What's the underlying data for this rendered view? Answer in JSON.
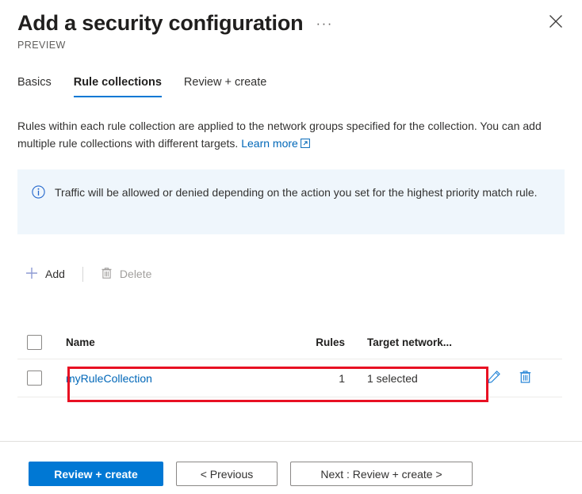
{
  "header": {
    "title": "Add a security configuration",
    "preview_label": "PREVIEW",
    "more_menu": "···",
    "close_icon": "close-icon"
  },
  "tabs": [
    {
      "label": "Basics",
      "active": false
    },
    {
      "label": "Rule collections",
      "active": true
    },
    {
      "label": "Review + create",
      "active": false
    }
  ],
  "description": {
    "line1": "Rules within each rule collection are applied to the network groups specified for the collection.",
    "line2": "You can add multiple rule collections with different targets.",
    "link_label": "Learn more",
    "link_icon": "external-link-icon"
  },
  "info_banner": {
    "icon": "info-circle-icon",
    "text": "Traffic will be allowed or denied depending on the action you set for the highest priority match rule.",
    "background": "#eff6fc"
  },
  "commandbar": {
    "add": {
      "label": "Add",
      "icon": "plus-icon",
      "disabled": false
    },
    "delete": {
      "label": "Delete",
      "icon": "trash-icon",
      "disabled": true
    }
  },
  "table": {
    "select_all_checkbox": false,
    "columns": [
      "Name",
      "Rules",
      "Target network..."
    ],
    "rows": [
      {
        "selected": false,
        "name": "myRuleCollection",
        "rules": "1",
        "target": "1 selected",
        "edit_icon": "pencil-icon",
        "delete_icon": "trash-icon"
      }
    ]
  },
  "highlight": {
    "color": "#e81123"
  },
  "footer": {
    "review_create": "Review + create",
    "previous": "< Previous",
    "next": "Next : Review + create >"
  },
  "colors": {
    "accent": "#0078d4",
    "link": "#0067b8",
    "highlight_red": "#e81123",
    "info_bg": "#eff6fc"
  }
}
